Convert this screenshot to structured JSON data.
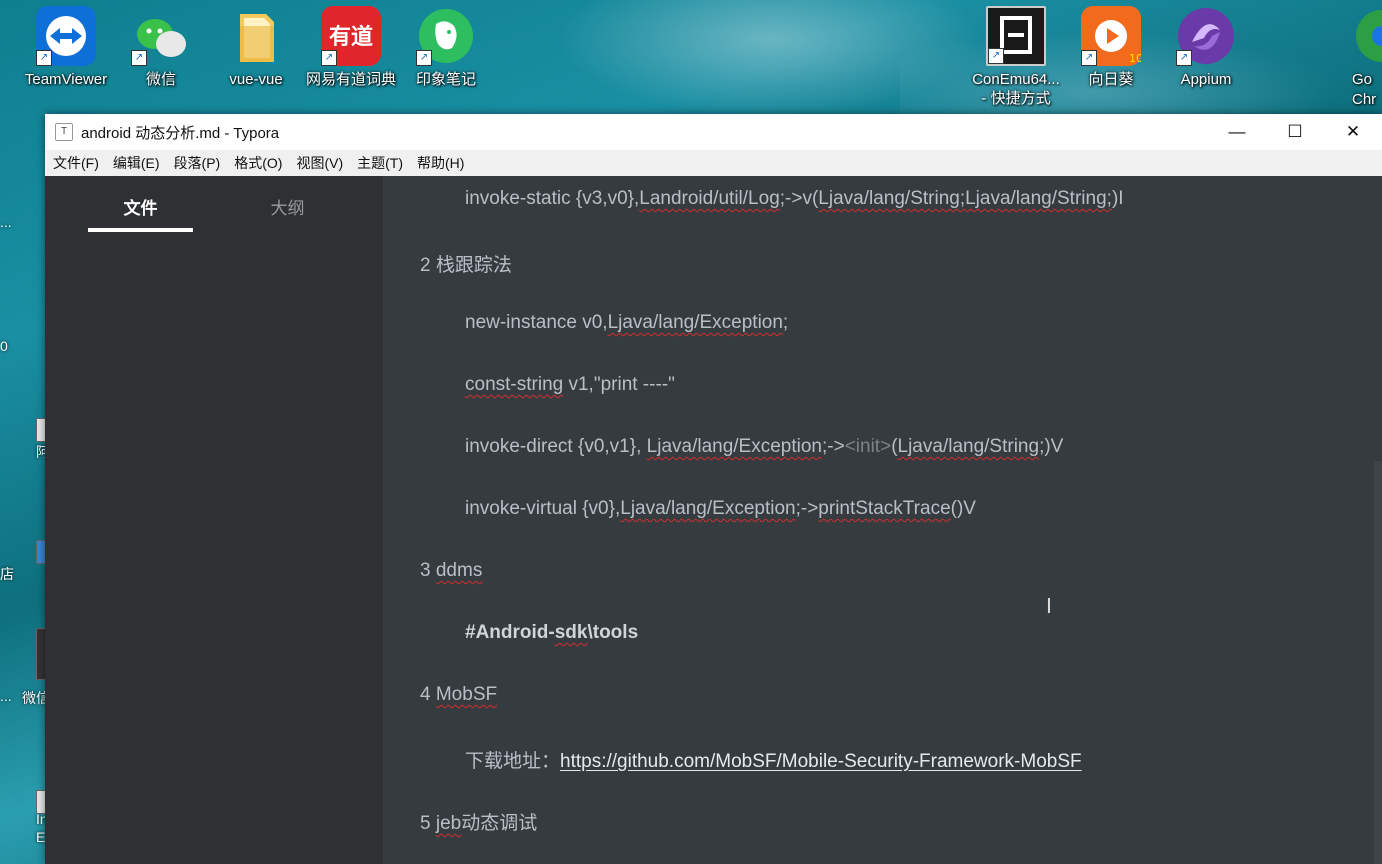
{
  "desktop": {
    "icons": [
      {
        "label": "TeamViewer"
      },
      {
        "label": "微信"
      },
      {
        "label": "vue-vue"
      },
      {
        "label": "网易有道词典"
      },
      {
        "label": "印象笔记"
      },
      {
        "label": "ConEmu64...\n- 快捷方式"
      },
      {
        "label": "向日葵"
      },
      {
        "label": "Appium"
      },
      {
        "label": "Go\nChr"
      }
    ],
    "left_fragments": [
      "...",
      "0",
      "阿",
      "店",
      "...",
      "微信",
      "In\nEx"
    ]
  },
  "window": {
    "title": "android 动态分析.md - Typora",
    "app_icon": "T",
    "controls": {
      "minimize": "—",
      "maximize": "☐",
      "close": "✕"
    }
  },
  "menu": [
    "文件(F)",
    "编辑(E)",
    "段落(P)",
    "格式(O)",
    "视图(V)",
    "主题(T)",
    "帮助(H)"
  ],
  "sidebar": {
    "tab_files": "文件",
    "tab_outline": "大纲"
  },
  "content": {
    "l1_a": "invoke-static {v3,v0},",
    "l1_b": "Landroid/util/Log",
    "l1_c": ";->v(",
    "l1_d": "Ljava/lang/String;Ljava/lang/String;",
    "l1_e": ")I",
    "h2_num": "2 ",
    "h2_text": "栈跟踪法",
    "l2_a": "new-instance v0,",
    "l2_b": "Ljava/lang/Exception",
    "l2_c": ";",
    "l3_a": "const-string",
    "l3_b": " v1,\"print ----\"",
    "l4_a": "invoke-direct {v0,v1}, ",
    "l4_b": "Ljava/lang/Exception",
    "l4_c": ";->",
    "l4_d": "<init>",
    "l4_e": "(",
    "l4_f": "Ljava/lang/String",
    "l4_g": ";)V",
    "l5_a": "invoke-virtual {v0},",
    "l5_b": "Ljava/lang/Exception",
    "l5_c": ";->",
    "l5_d": "printStackTrace",
    "l5_e": "()V",
    "h3_num": "3 ",
    "h3_text": "ddms",
    "l6_a": "#Android-",
    "l6_b": "sdk",
    "l6_c": "\\tools",
    "h4_num": "4 ",
    "h4_text": "MobSF",
    "l7_label": "下载地址：",
    "l7_link": "https://github.com/MobSF/Mobile-Security-Framework-MobSF",
    "h5_num": "5 ",
    "h5_a": "jeb",
    "h5_b": "动态调试"
  }
}
